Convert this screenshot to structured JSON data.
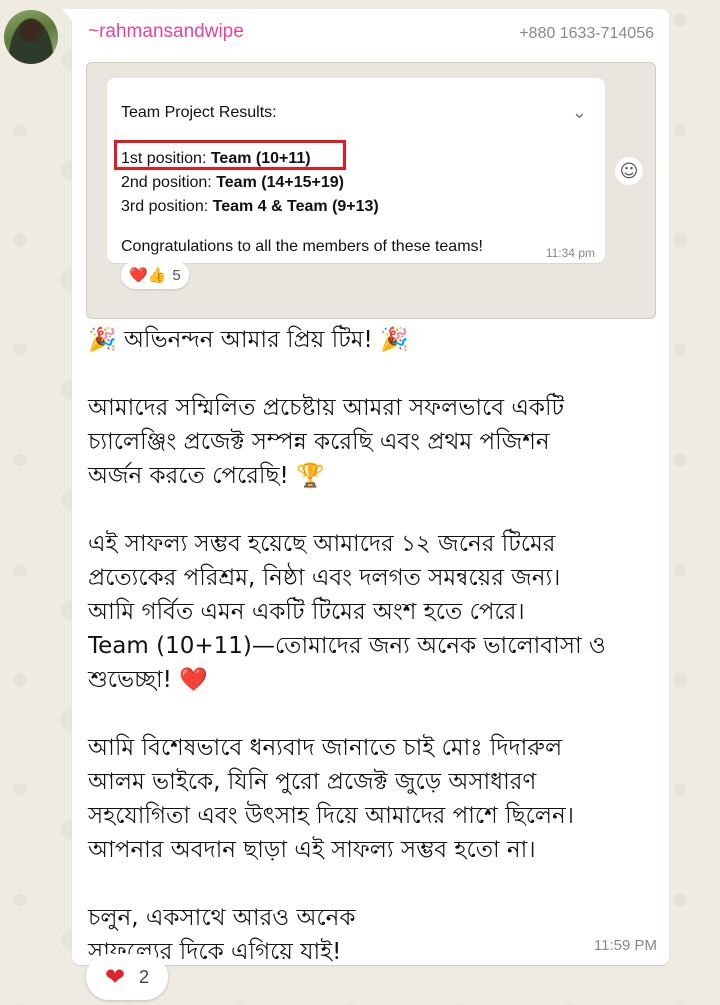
{
  "sender": {
    "name": "~rahmansandwipe",
    "phone": "+880 1633-714056"
  },
  "quoted_screenshot": {
    "title": "Team Project Results:",
    "results": [
      {
        "prefix": "1st position: ",
        "team": "Team (10+11)"
      },
      {
        "prefix": "2nd position: ",
        "team": "Team (14+15+19)"
      },
      {
        "prefix": "3rd position: ",
        "team": "Team 4 & Team (9+13)"
      }
    ],
    "congrats": "Congratulations to all the members of these teams!",
    "time": "11:34 pm",
    "reactions": {
      "emojis": "❤️👍",
      "count": "5"
    }
  },
  "message": {
    "paragraphs": [
      "🎉 অভিনন্দন আমার প্রিয় টিম! 🎉",
      "আমাদের সম্মিলিত প্রচেষ্টায় আমরা সফলভাবে একটি\nচ্যালেঞ্জিং প্রজেক্ট সম্পন্ন করেছি এবং প্রথম পজিশন\nঅর্জন করতে পেরেছি! 🏆",
      "এই সাফল্য সম্ভব হয়েছে আমাদের ১২ জনের টিমের\nপ্রত্যেকের পরিশ্রম, নিষ্ঠা এবং দলগত সমন্বয়ের জন্য।\nআমি গর্বিত এমন একটি টিমের অংশ হতে পেরে।\nTeam (10+11)—তোমাদের জন্য অনেক ভালোবাসা ও\nশুভেচ্ছা! ❤️",
      "আমি বিশেষভাবে ধন্যবাদ জানাতে চাই মোঃ দিদারুল\nআলম ভাইকে, যিনি পুরো প্রজেক্ট জুড়ে অসাধারণ\nসহযোগিতা এবং উৎসাহ দিয়ে আমাদের পাশে ছিলেন।\nআপনার অবদান ছাড়া এই সাফল্য সম্ভব হতো না।",
      "চলুন, একসাথে আরও অনেক\nসাফল্যের দিকে এগিয়ে যাই!"
    ],
    "time": "11:59 PM"
  },
  "reaction": {
    "emoji": "❤",
    "count": "2"
  },
  "colors": {
    "sender": "#e542a3",
    "highlight": "#e01b24",
    "background": "#efeae2"
  }
}
